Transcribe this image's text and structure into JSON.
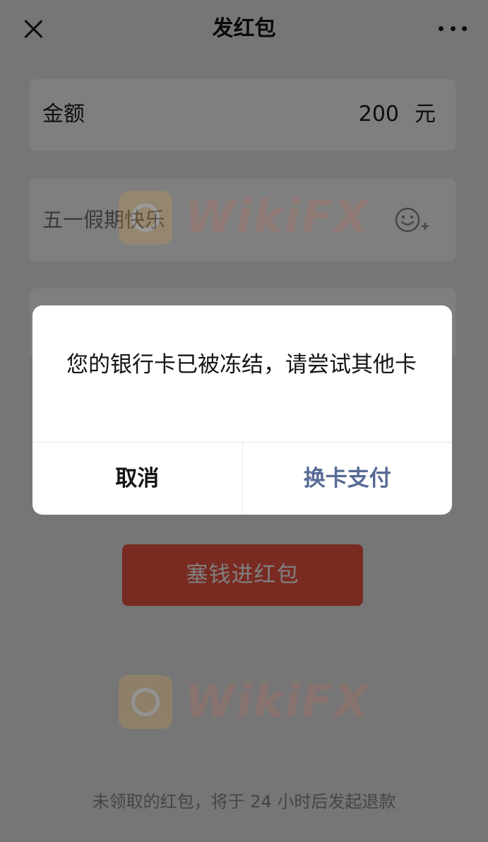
{
  "header": {
    "title": "发红包"
  },
  "amount": {
    "label": "金额",
    "value": "200",
    "unit": "元"
  },
  "greeting": {
    "placeholder": "五一假期快乐"
  },
  "send_button": {
    "label": "塞钱进红包"
  },
  "refund_note": "未领取的红包，将于 24 小时后发起退款",
  "dialog": {
    "message": "您的银行卡已被冻结，请尝试其他卡",
    "cancel_label": "取消",
    "confirm_label": "换卡支付"
  },
  "watermark": {
    "text": "WikiFX"
  },
  "colors": {
    "accent_red": "#f25543",
    "link_blue": "#576b95"
  }
}
